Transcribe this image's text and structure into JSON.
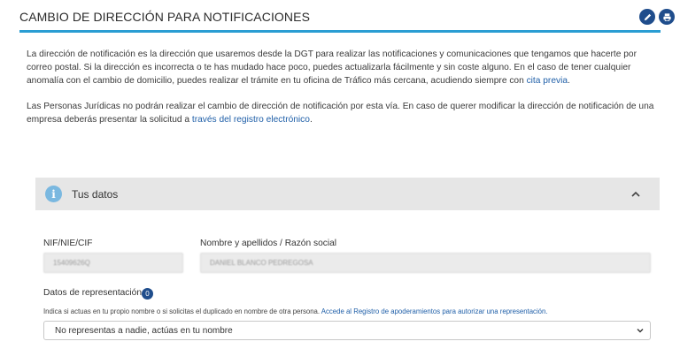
{
  "header": {
    "title": "CAMBIO DE DIRECCIÓN PARA NOTIFICACIONES",
    "edit_icon": "edit-icon",
    "print_icon": "print-icon",
    "accent_color": "#2a9dd3"
  },
  "intro": {
    "p1_text": "La dirección de notificación es la dirección que usaremos desde la DGT para realizar las notificaciones y comunicaciones que tengamos que hacerte por correo postal. Si la dirección es incorrecta o te has mudado hace poco, puedes actualizarla fácilmente y sin coste alguno. En el caso de tener cualquier anomalía con el cambio de domicilio, puedes realizar el trámite en tu oficina de Tráfico más cercana, acudiendo siempre con ",
    "p1_link": "cita previa",
    "p1_end": ".",
    "p2_text": "Las Personas Jurídicas no podrán realizar el cambio de dirección de notificación por esta vía. En caso de querer modificar la dirección de notificación de una empresa deberás presentar la solicitud a ",
    "p2_link": "través del registro electrónico",
    "p2_end": "."
  },
  "panel": {
    "title": "Tus datos",
    "info_icon": "i"
  },
  "form": {
    "nif_label": "NIF/NIE/CIF",
    "nif_value": "15409626Q",
    "name_label": "Nombre y apellidos / Razón social",
    "name_value": "DANIEL BLANCO PEDREGOSA",
    "repr_label": "Datos de representación",
    "repr_badge": "0",
    "hint_text": "Indica si actuas en tu propio nombre o si solicitas el duplicado en nombre de otra persona. ",
    "hint_link": "Accede al Registro de apoderamientos para autorizar una representación.",
    "repr_selected": "No representas a nadie, actúas en tu nombre"
  }
}
